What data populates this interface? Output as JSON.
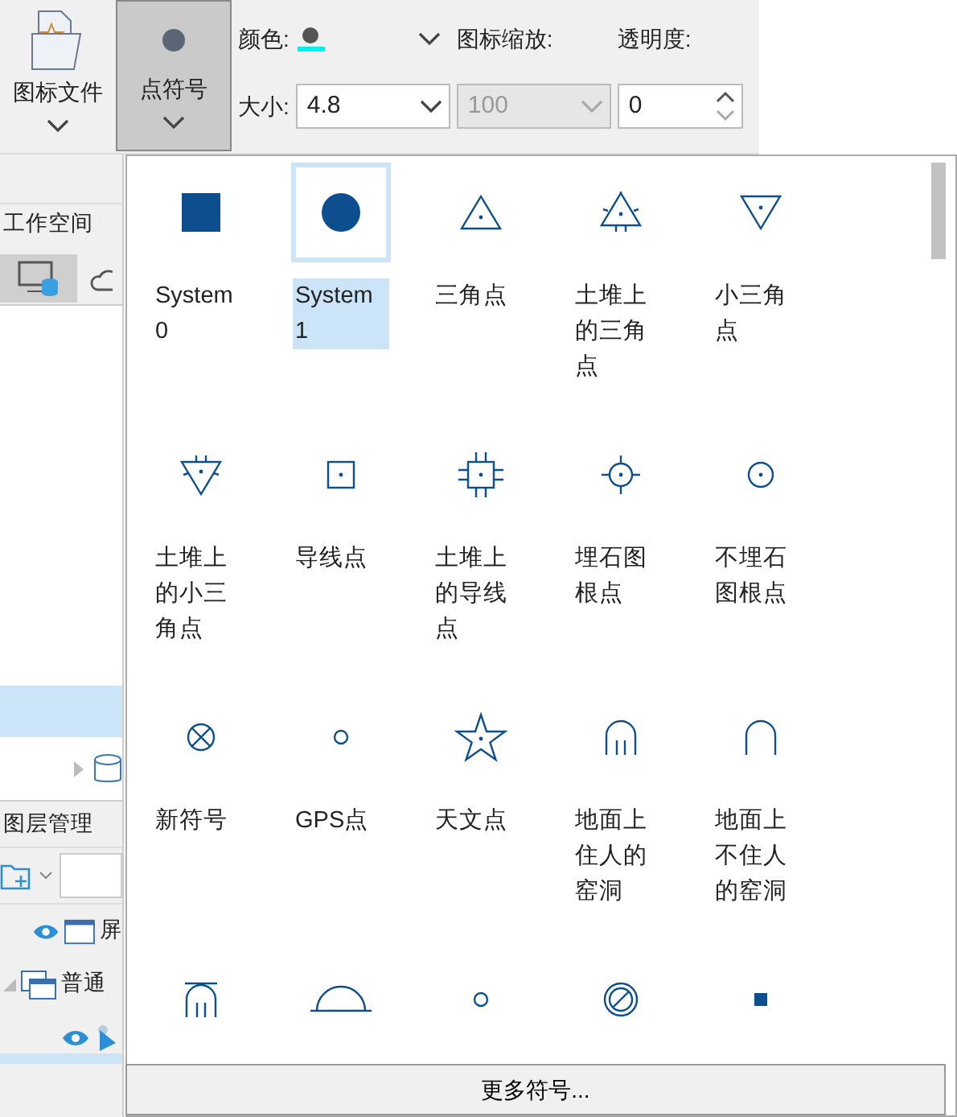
{
  "toolbar": {
    "icon_file_button": "图标文件",
    "point_symbol_button": {
      "label": "点符号",
      "pressed": true
    },
    "color_label": "颜色:",
    "icon_scale_label": "图标缩放:",
    "opacity_label": "透明度:",
    "size_label": "大小:",
    "size_value": "4.8",
    "scale_value": {
      "value": "100",
      "disabled": true
    },
    "opacity_value": "0"
  },
  "left_panel": {
    "workspace_title": "工作空间",
    "layer_title": "图层管理",
    "layer_items": [
      {
        "label": "屏"
      },
      {
        "label": "普通"
      }
    ]
  },
  "symbols": [
    {
      "kind": "filled-square",
      "label": "System 0",
      "selected": false
    },
    {
      "kind": "filled-circle",
      "label": "System 1",
      "selected": true
    },
    {
      "kind": "triangle",
      "label": "三角点",
      "selected": false
    },
    {
      "kind": "mound-triangle",
      "label": "土堆上的三角点",
      "selected": false
    },
    {
      "kind": "inverted-triangle",
      "label": "小三角点",
      "selected": false
    },
    {
      "kind": "mound-inverted-triangle",
      "label": "土堆上的小三角点",
      "selected": false
    },
    {
      "kind": "dot-square",
      "label": "导线点",
      "selected": false
    },
    {
      "kind": "mound-square",
      "label": "土堆上的导线点",
      "selected": false
    },
    {
      "kind": "crosshair",
      "label": "埋石图根点",
      "selected": false
    },
    {
      "kind": "dot-circle",
      "label": "不埋石图根点",
      "selected": false
    },
    {
      "kind": "x-circle",
      "label": "新符号",
      "selected": false
    },
    {
      "kind": "ring",
      "label": "GPS点",
      "selected": false
    },
    {
      "kind": "star",
      "label": "天文点",
      "selected": false
    },
    {
      "kind": "arch-lines",
      "label": "地面上住人的窑洞",
      "selected": false
    },
    {
      "kind": "arch",
      "label": "地面上不住人的窑洞",
      "selected": false
    },
    {
      "kind": "arch-bar",
      "selected": false
    },
    {
      "kind": "dome",
      "selected": false
    },
    {
      "kind": "ring",
      "selected": false
    },
    {
      "kind": "slash-circle",
      "selected": false
    },
    {
      "kind": "small-square",
      "selected": false
    }
  ],
  "more_button": "更多符号..."
}
